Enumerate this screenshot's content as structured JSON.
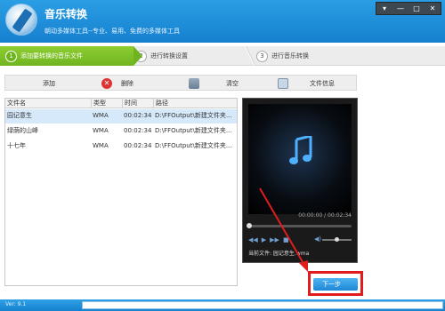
{
  "app": {
    "title": "音乐转换",
    "subtitle": "朝动多媒体工具--专业、易用、免费的多媒体工具",
    "version": "Ver: 9.1"
  },
  "window_controls": [
    "▾",
    "—",
    "□",
    "✕"
  ],
  "steps": [
    {
      "num": "1",
      "label": "添加要转换的音乐文件",
      "active": true
    },
    {
      "num": "2",
      "label": "进行转换设置",
      "active": false
    },
    {
      "num": "3",
      "label": "进行音乐转换",
      "active": false
    }
  ],
  "toolbar": {
    "add": "添加",
    "delete": "删除",
    "clear": "清空",
    "file_info": "文件信息"
  },
  "filelist": {
    "columns": [
      "文件名",
      "类型",
      "时间",
      "路径"
    ],
    "rows": [
      {
        "name": "园记意生",
        "type": "WMA",
        "time": "00:02:34",
        "path": "D:\\FFOutput\\新建文件夹...",
        "selected": true
      },
      {
        "name": "绿荫的山峰",
        "type": "WMA",
        "time": "00:02:34",
        "path": "D:\\FFOutput\\新建文件夹...",
        "selected": false
      },
      {
        "name": "十七年",
        "type": "WMA",
        "time": "00:02:34",
        "path": "D:\\FFOutput\\新建文件夹...",
        "selected": false
      }
    ]
  },
  "player": {
    "timecode": "00:00:00 / 00:02:34",
    "current_file": "当前文件: 园记意生.wma",
    "controls": [
      "◀◀",
      "▶",
      "▶▶",
      "■"
    ],
    "volume_icon": "◀)"
  },
  "next_button": "下一步",
  "colors": {
    "header": "#1680cf",
    "active_step": "#6fb420",
    "highlight": "#e01c1c"
  }
}
